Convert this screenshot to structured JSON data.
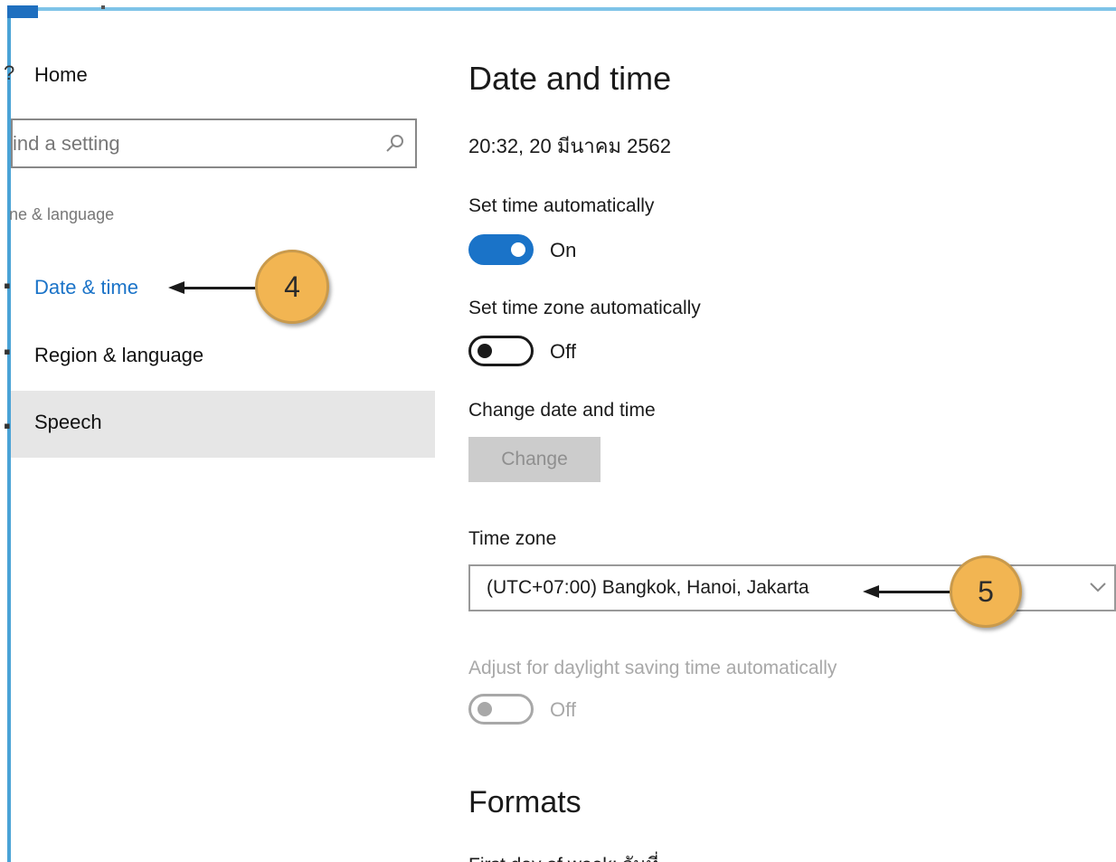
{
  "sidebar": {
    "home_label": "Home",
    "search_placeholder": "ind a setting",
    "category_label": "ne & language",
    "items": [
      {
        "label": "Date & time",
        "active": true
      },
      {
        "label": "Region & language"
      },
      {
        "label": "Speech"
      }
    ]
  },
  "main": {
    "title": "Date and time",
    "current_datetime": "20:32, 20 มีนาคม 2562",
    "set_time_auto": {
      "label": "Set time automatically",
      "state": "On"
    },
    "set_timezone_auto": {
      "label": "Set time zone automatically",
      "state": "Off"
    },
    "change_datetime": {
      "label": "Change date and time",
      "button_label": "Change"
    },
    "time_zone": {
      "label": "Time zone",
      "value": "(UTC+07:00) Bangkok, Hanoi, Jakarta"
    },
    "daylight_saving": {
      "label": "Adjust for daylight saving time automatically",
      "state": "Off"
    },
    "formats_heading": "Formats",
    "formats_first_row": "First day of week:     วันที่"
  },
  "callouts": {
    "step_4": "4",
    "step_5": "5"
  },
  "colors": {
    "accent": "#1a73c8",
    "callout_fill": "#f2b552",
    "selected_bg": "#e6e6e6",
    "window_border": "#4aa3d6"
  }
}
